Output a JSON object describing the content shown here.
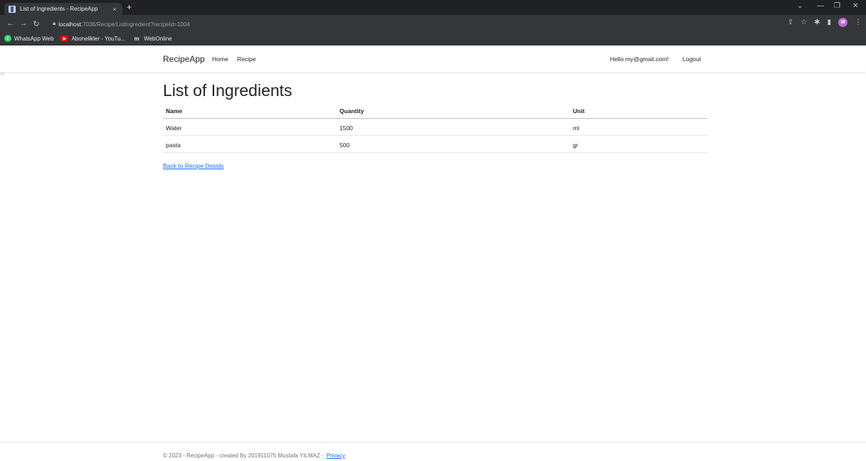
{
  "browser": {
    "tab_title": "List of Ingredients - RecipeApp",
    "tab_close": "×",
    "new_tab": "+",
    "url_host": "localhost",
    "url_rest": ":7036/Recipe/ListIngredient?recipeId=1004",
    "avatar_letter": "M",
    "bookmarks": [
      {
        "label": "WhatsApp Web",
        "icon": "whatsapp-icon"
      },
      {
        "label": "Abonelikler - YouTu...",
        "icon": "youtube-icon"
      },
      {
        "label": "WebOnline",
        "icon": "webonline-icon"
      }
    ]
  },
  "navbar": {
    "brand": "RecipeApp",
    "links": [
      "Home",
      "Recipe"
    ],
    "greeting": "Hello my@gmail.com!",
    "logout": "Logout"
  },
  "main": {
    "title": "List of Ingredients",
    "table": {
      "headers": [
        "Name",
        "Quantity",
        "Unit"
      ],
      "rows": [
        [
          "Water",
          "1500",
          "ml"
        ],
        [
          "pasta",
          "500",
          "gr"
        ]
      ]
    },
    "back_link": "Back to Recipe Details"
  },
  "footer": {
    "text": "© 2023 - RecipeApp - created By 201911075 Mustafa YILMAZ -",
    "privacy": "Privacy"
  }
}
